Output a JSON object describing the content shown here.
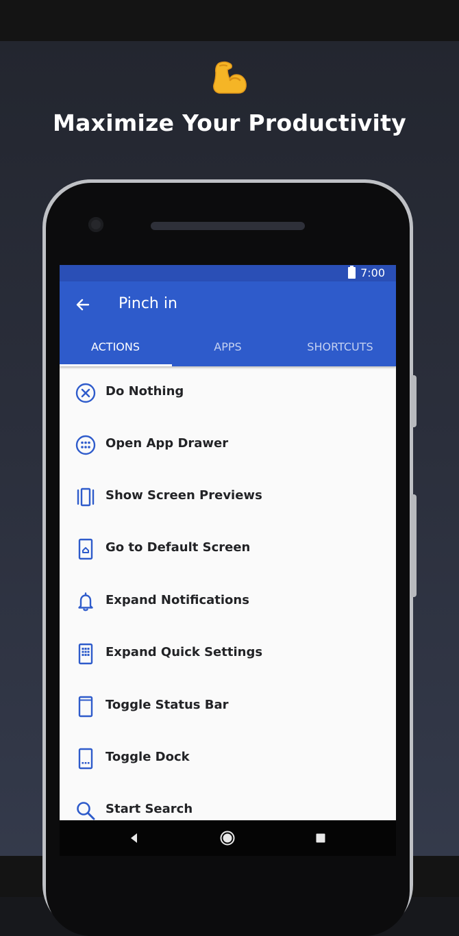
{
  "promo": {
    "emoji": "💪",
    "title": "Maximize Your Productivity"
  },
  "status_bar": {
    "time": "7:00"
  },
  "app_bar": {
    "title": "Pinch in",
    "tabs": [
      {
        "label": "ACTIONS",
        "active": true
      },
      {
        "label": "APPS",
        "active": false
      },
      {
        "label": "SHORTCUTS",
        "active": false
      }
    ]
  },
  "actions": [
    {
      "label": "Do Nothing",
      "icon": "close-circle-icon"
    },
    {
      "label": "Open App Drawer",
      "icon": "app-drawer-icon"
    },
    {
      "label": "Show Screen Previews",
      "icon": "screen-previews-icon"
    },
    {
      "label": "Go to Default Screen",
      "icon": "default-screen-icon"
    },
    {
      "label": "Expand Notifications",
      "icon": "bell-icon"
    },
    {
      "label": "Expand Quick Settings",
      "icon": "quick-settings-icon"
    },
    {
      "label": "Toggle Status Bar",
      "icon": "status-bar-icon"
    },
    {
      "label": "Toggle Dock",
      "icon": "dock-icon"
    },
    {
      "label": "Start Search",
      "icon": "search-icon"
    }
  ],
  "colors": {
    "accent": "#2e5bcb",
    "status_bar": "#2a4fb6",
    "icon": "#2e5bcb",
    "list_background": "#fafafa",
    "page_background": "#2b2f3c"
  }
}
